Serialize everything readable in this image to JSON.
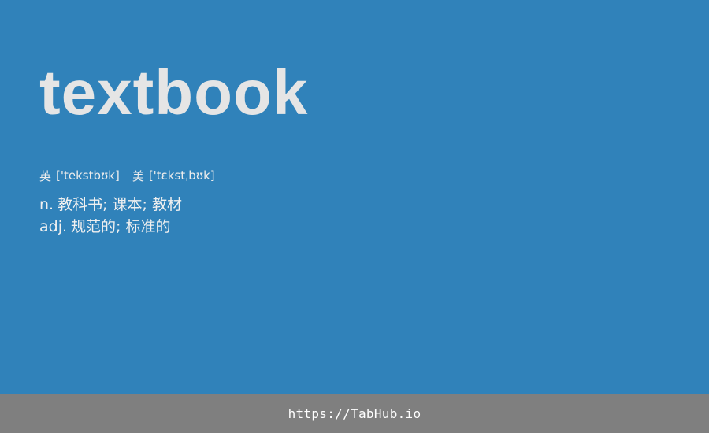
{
  "entry": {
    "word": "textbook",
    "phonetics": [
      {
        "region": "英",
        "ipa": "['tekstbʊk]"
      },
      {
        "region": "美",
        "ipa": "['tɛkstˌbʊk]"
      }
    ],
    "definitions": [
      {
        "pos": "n.",
        "meaning": "教科书; 课本; 教材"
      },
      {
        "pos": "adj.",
        "meaning": "规范的; 标准的"
      }
    ]
  },
  "footer": {
    "link_text": "https://TabHub.io"
  },
  "colors": {
    "background": "#3082ba",
    "word": "#e5e5e5",
    "footer_bar": "#7f7f7f",
    "footer_text": "#ffffff"
  }
}
